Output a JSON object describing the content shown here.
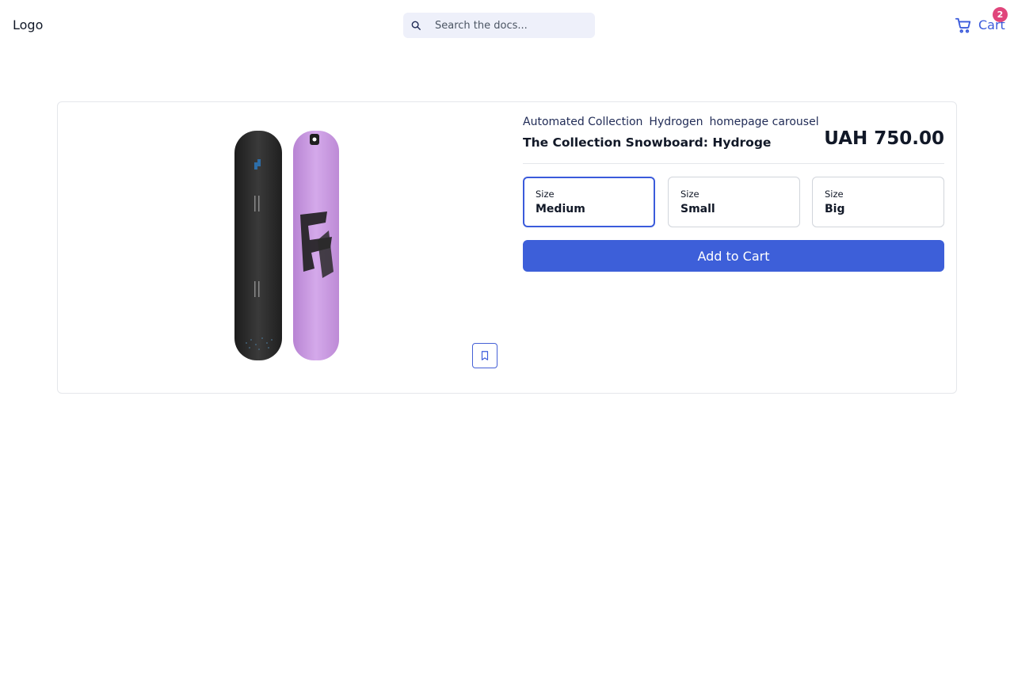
{
  "header": {
    "logo_text": "Logo",
    "search": {
      "placeholder": "Search the docs...",
      "icon": "search-icon"
    },
    "cart": {
      "label": "Cart",
      "count": "2",
      "icon": "cart-icon"
    }
  },
  "product": {
    "tags": [
      "Automated Collection",
      "Hydrogen",
      "homepage carousel"
    ],
    "title": "The Collection Snowboard: Hydroge",
    "price": "UAH 750.00",
    "image_alt": "snowboard-image",
    "bookmark_icon": "bookmark-icon",
    "options": [
      {
        "label": "Size",
        "value": "Medium",
        "selected": true
      },
      {
        "label": "Size",
        "value": "Small",
        "selected": false
      },
      {
        "label": "Size",
        "value": "Big",
        "selected": false
      }
    ],
    "add_to_cart_label": "Add to Cart"
  },
  "colors": {
    "accent": "#3d5fd9",
    "badge": "#e0457b",
    "board_dark": "#2b2b2b",
    "board_purple": "#c99be0"
  }
}
